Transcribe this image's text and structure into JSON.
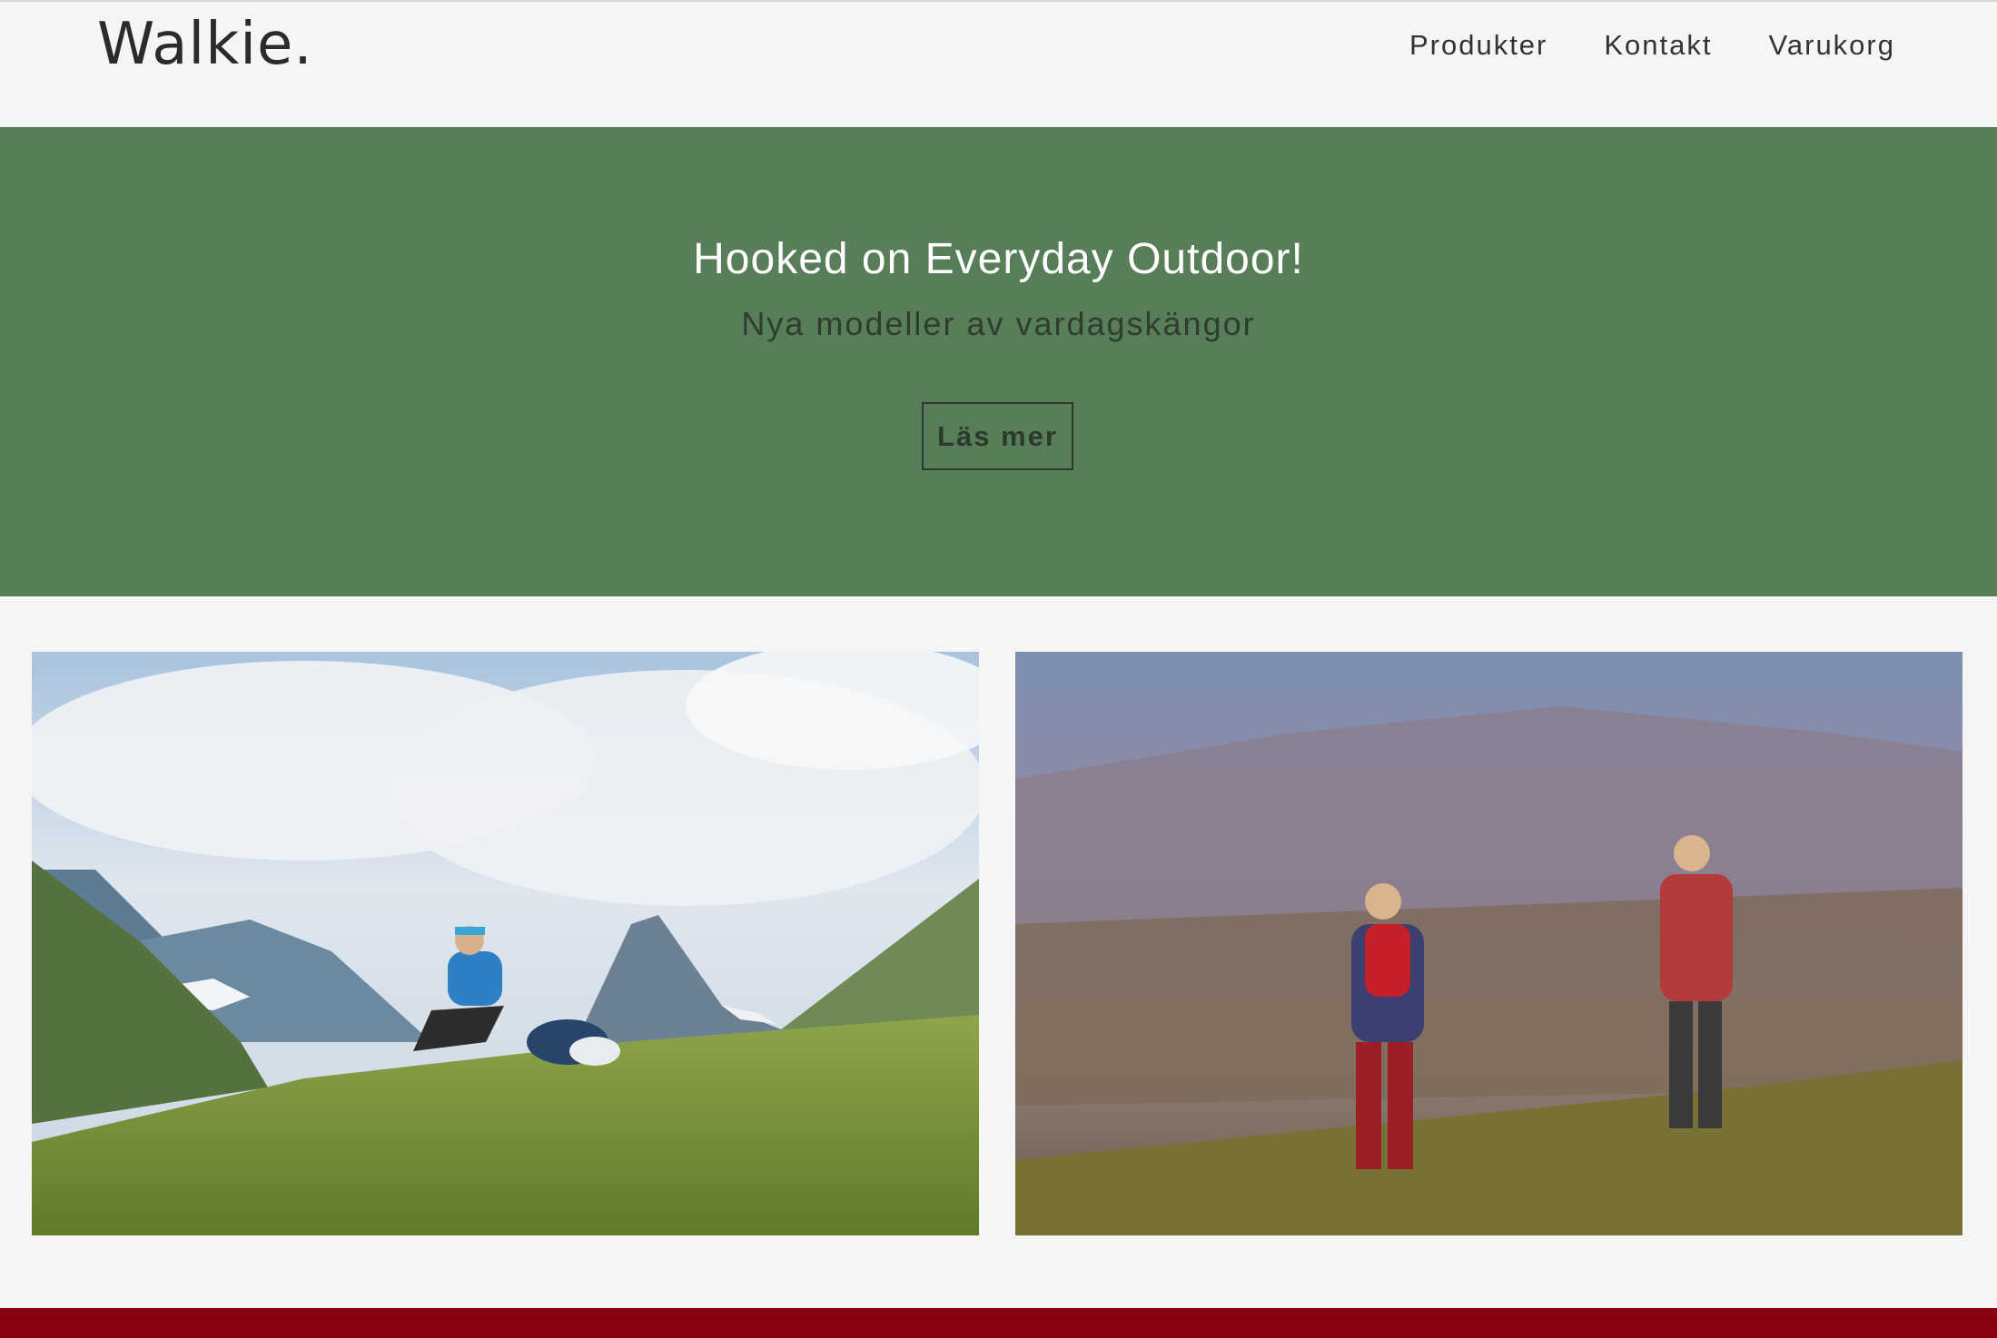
{
  "header": {
    "logo": "Walkie.",
    "nav": [
      {
        "label": "Produkter"
      },
      {
        "label": "Kontakt"
      },
      {
        "label": "Varukorg"
      }
    ]
  },
  "hero": {
    "title": "Hooked on Everyday Outdoor!",
    "subtitle": "Nya modeller av vardagskängor",
    "button_label": "Läs mer",
    "background_color": "#577e58"
  },
  "footer": {
    "accent_color": "#8a0010"
  }
}
